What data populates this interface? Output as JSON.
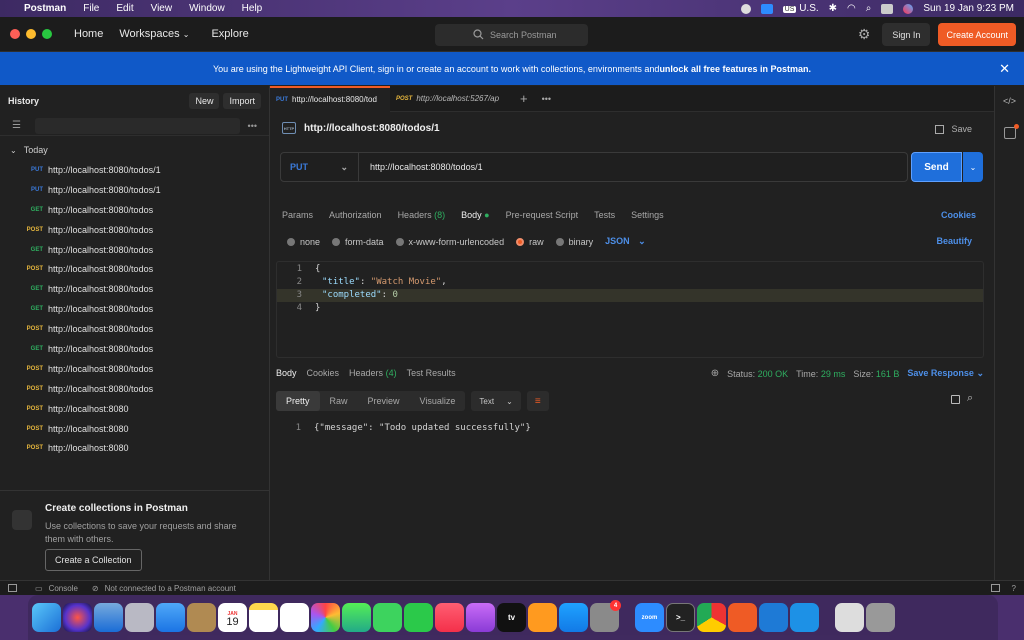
{
  "menubar": {
    "app": "Postman",
    "items": [
      "File",
      "Edit",
      "View",
      "Window",
      "Help"
    ],
    "input_source": "U.S.",
    "datetime": "Sun 19 Jan  9:23 PM"
  },
  "titlebar": {
    "nav": [
      "Home",
      "Workspaces",
      "Explore"
    ],
    "search_placeholder": "Search Postman",
    "sign_in": "Sign In",
    "create_account": "Create Account"
  },
  "banner": {
    "text": "You are using the Lightweight API Client, sign in or create an account to work with collections, environments and ",
    "bold": "unlock all free features in Postman."
  },
  "sidebar": {
    "title": "History",
    "new_label": "New",
    "import_label": "Import",
    "group": "Today",
    "items": [
      {
        "method": "PUT",
        "url": "http://localhost:8080/todos/1"
      },
      {
        "method": "PUT",
        "url": "http://localhost:8080/todos/1"
      },
      {
        "method": "GET",
        "url": "http://localhost:8080/todos"
      },
      {
        "method": "POST",
        "url": "http://localhost:8080/todos"
      },
      {
        "method": "GET",
        "url": "http://localhost:8080/todos"
      },
      {
        "method": "POST",
        "url": "http://localhost:8080/todos"
      },
      {
        "method": "GET",
        "url": "http://localhost:8080/todos"
      },
      {
        "method": "GET",
        "url": "http://localhost:8080/todos"
      },
      {
        "method": "POST",
        "url": "http://localhost:8080/todos"
      },
      {
        "method": "GET",
        "url": "http://localhost:8080/todos"
      },
      {
        "method": "POST",
        "url": "http://localhost:8080/todos"
      },
      {
        "method": "POST",
        "url": "http://localhost:8080/todos"
      },
      {
        "method": "POST",
        "url": "http://localhost:8080"
      },
      {
        "method": "POST",
        "url": "http://localhost:8080"
      },
      {
        "method": "POST",
        "url": "http://localhost:8080"
      }
    ],
    "promo": {
      "title": "Create collections in Postman",
      "desc": "Use collections to save your requests and share them with others.",
      "button": "Create a Collection"
    }
  },
  "tabs": [
    {
      "method": "PUT",
      "label": "http://localhost:8080/tod",
      "active": true
    },
    {
      "method": "POST",
      "label": "http://localhost:5267/ap",
      "active": false
    }
  ],
  "request": {
    "title": "http://localhost:8080/todos/1",
    "save": "Save",
    "method": "PUT",
    "url": "http://localhost:8080/todos/1",
    "send": "Send",
    "tabs": [
      "Params",
      "Authorization",
      "Headers",
      "Body",
      "Pre-request Script",
      "Tests",
      "Settings"
    ],
    "headers_count": "(8)",
    "cookies": "Cookies",
    "body_types": [
      "none",
      "form-data",
      "x-www-form-urlencoded",
      "raw",
      "binary"
    ],
    "format": "JSON",
    "beautify": "Beautify",
    "body_lines": [
      {
        "n": "1",
        "text": "{"
      },
      {
        "n": "2",
        "key": "\"title\"",
        "sep": ": ",
        "val": "\"Watch Movie\"",
        "tail": ","
      },
      {
        "n": "3",
        "key": "\"completed\"",
        "sep": ": ",
        "val": "0",
        "tail": ""
      },
      {
        "n": "4",
        "text": "}"
      }
    ]
  },
  "response": {
    "tabs": [
      "Body",
      "Cookies",
      "Headers",
      "Test Results"
    ],
    "headers_count": "(4)",
    "status_label": "Status:",
    "status": "200 OK",
    "time_label": "Time:",
    "time": "29 ms",
    "size_label": "Size:",
    "size": "161 B",
    "save_response": "Save Response",
    "views": [
      "Pretty",
      "Raw",
      "Preview",
      "Visualize"
    ],
    "type": "Text",
    "line_no": "1",
    "body": "{\"message\": \"Todo updated successfully\"}"
  },
  "statusbar": {
    "console": "Console",
    "status": "Not connected to a Postman account"
  },
  "dock": {
    "calendar_month": "JAN",
    "calendar_day": "19",
    "appstore_badge": "4",
    "zoom_label": "zoom"
  }
}
